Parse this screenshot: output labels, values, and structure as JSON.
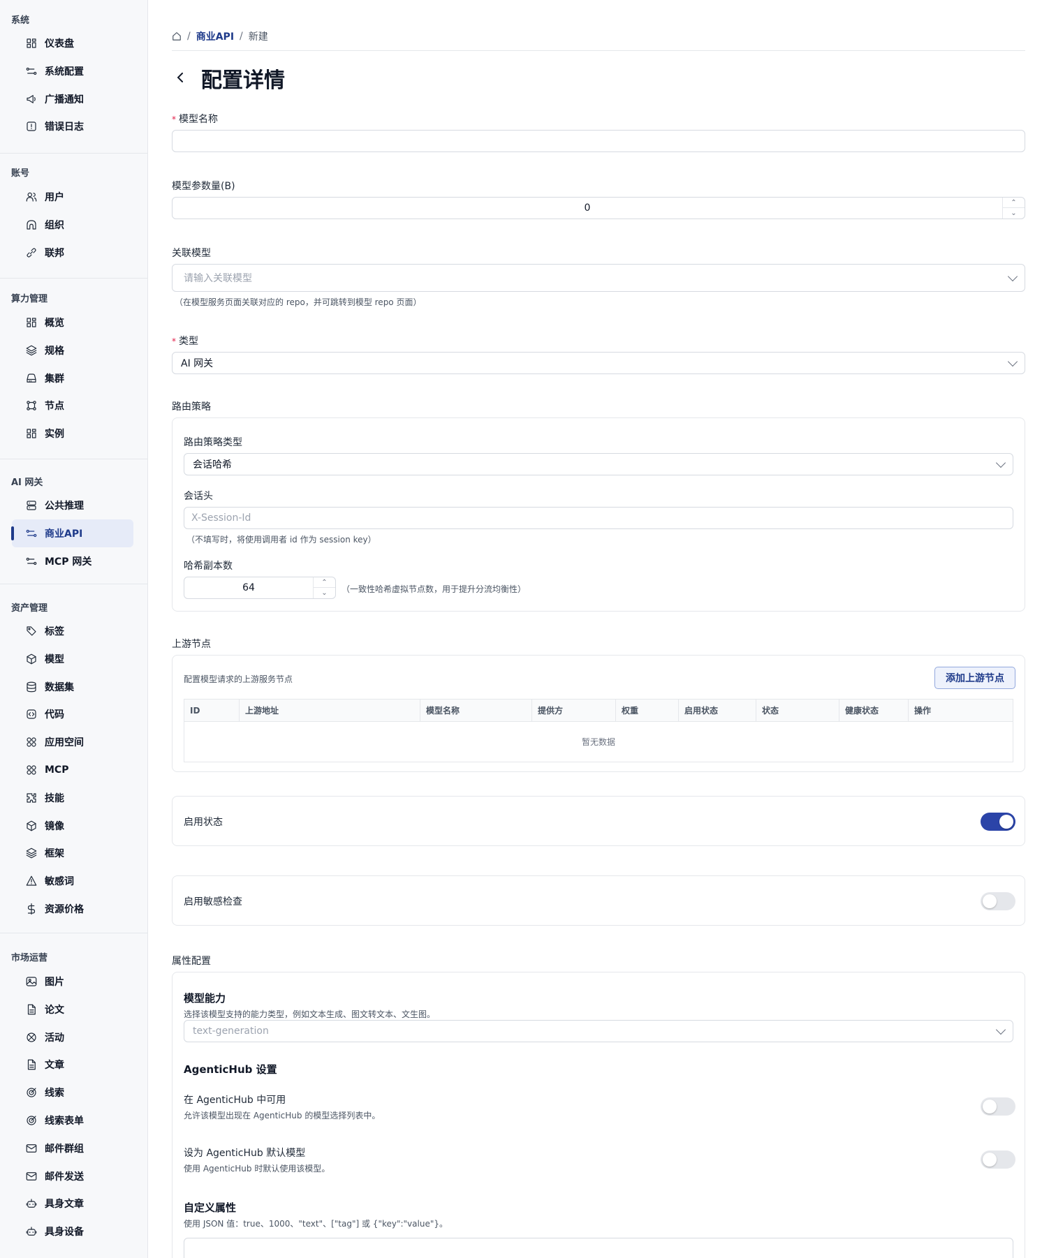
{
  "sidebar": {
    "sections": [
      {
        "title": "系统",
        "items": [
          {
            "label": "仪表盘",
            "icon": "grid-icon"
          },
          {
            "label": "系统配置",
            "icon": "route-icon"
          },
          {
            "label": "广播通知",
            "icon": "megaphone-icon"
          },
          {
            "label": "错误日志",
            "icon": "alert-square-icon"
          }
        ]
      },
      {
        "title": "账号",
        "items": [
          {
            "label": "用户",
            "icon": "users-icon"
          },
          {
            "label": "组织",
            "icon": "building-icon"
          },
          {
            "label": "联邦",
            "icon": "link-icon"
          }
        ]
      },
      {
        "title": "算力管理",
        "items": [
          {
            "label": "概览",
            "icon": "grid-icon"
          },
          {
            "label": "规格",
            "icon": "layers-icon"
          },
          {
            "label": "集群",
            "icon": "hard-drive-icon"
          },
          {
            "label": "节点",
            "icon": "nodes-icon"
          },
          {
            "label": "实例",
            "icon": "grid-icon"
          }
        ]
      },
      {
        "title": "AI 网关",
        "items": [
          {
            "label": "公共推理",
            "icon": "server-icon"
          },
          {
            "label": "商业API",
            "icon": "route-icon",
            "active": true
          },
          {
            "label": "MCP 网关",
            "icon": "route-icon"
          }
        ]
      },
      {
        "title": "资产管理",
        "items": [
          {
            "label": "标签",
            "icon": "tag-icon"
          },
          {
            "label": "模型",
            "icon": "box-icon"
          },
          {
            "label": "数据集",
            "icon": "database-icon"
          },
          {
            "label": "代码",
            "icon": "code-icon"
          },
          {
            "label": "应用空间",
            "icon": "apps-icon"
          },
          {
            "label": "MCP",
            "icon": "apps-icon"
          },
          {
            "label": "技能",
            "icon": "puzzle-icon"
          },
          {
            "label": "镜像",
            "icon": "box-icon"
          },
          {
            "label": "框架",
            "icon": "layers-icon"
          },
          {
            "label": "敏感词",
            "icon": "warning-icon"
          },
          {
            "label": "资源价格",
            "icon": "dollar-icon"
          }
        ]
      },
      {
        "title": "市场运营",
        "items": [
          {
            "label": "图片",
            "icon": "image-icon"
          },
          {
            "label": "论文",
            "icon": "file-icon"
          },
          {
            "label": "活动",
            "icon": "activity-icon"
          },
          {
            "label": "文章",
            "icon": "file-icon"
          },
          {
            "label": "线索",
            "icon": "target-icon"
          },
          {
            "label": "线索表单",
            "icon": "target-icon"
          },
          {
            "label": "邮件群组",
            "icon": "mail-icon"
          },
          {
            "label": "邮件发送",
            "icon": "mail-icon"
          },
          {
            "label": "具身文章",
            "icon": "bot-icon"
          },
          {
            "label": "具身设备",
            "icon": "bot-icon"
          }
        ]
      }
    ]
  },
  "breadcrumb": {
    "link": "商业API",
    "current": "新建",
    "sep": "/"
  },
  "page_title": "配置详情",
  "form": {
    "model_name": {
      "label": "模型名称",
      "value": ""
    },
    "param_count": {
      "label": "模型参数量(B)",
      "value": "0"
    },
    "related_model": {
      "label": "关联模型",
      "placeholder": "请输入关联模型",
      "help": "（在模型服务页面关联对应的 repo，并可跳转到模型 repo 页面）"
    },
    "type": {
      "label": "类型",
      "value": "AI 网关"
    },
    "routing": {
      "label": "路由策略",
      "strategy_type": {
        "label": "路由策略类型",
        "value": "会话哈希"
      },
      "session_header": {
        "label": "会话头",
        "placeholder": "X-Session-Id",
        "help": "（不填写时，将使用调用者 id 作为 session key）"
      },
      "replicas": {
        "label": "哈希副本数",
        "value": "64",
        "help": "（一致性哈希虚拟节点数，用于提升分流均衡性）"
      }
    },
    "upstream": {
      "label": "上游节点",
      "desc": "配置模型请求的上游服务节点",
      "add_button": "添加上游节点",
      "columns": [
        "ID",
        "上游地址",
        "模型名称",
        "提供方",
        "权重",
        "启用状态",
        "状态",
        "健康状态",
        "操作"
      ],
      "empty": "暂无数据"
    },
    "enable": {
      "label": "启用状态",
      "on": true
    },
    "sensitive": {
      "label": "启用敏感检查",
      "on": false
    },
    "attributes": {
      "label": "属性配置",
      "capability": {
        "title": "模型能力",
        "desc": "选择该模型支持的能力类型，例如文本生成、图文转文本、文生图。",
        "placeholder": "text-generation"
      },
      "agentichub": {
        "title": "AgenticHub 设置",
        "available": {
          "title": "在 AgenticHub 中可用",
          "desc": "允许该模型出现在 AgenticHub 的模型选择列表中。",
          "on": false
        },
        "default": {
          "title": "设为 AgenticHub 默认模型",
          "desc": "使用 AgenticHub 时默认使用该模型。",
          "on": false
        }
      },
      "custom": {
        "title": "自定义属性",
        "desc": "使用 JSON 值：true、1000、\"text\"、[\"tag\"] 或 {\"key\":\"value\"}。"
      }
    }
  }
}
